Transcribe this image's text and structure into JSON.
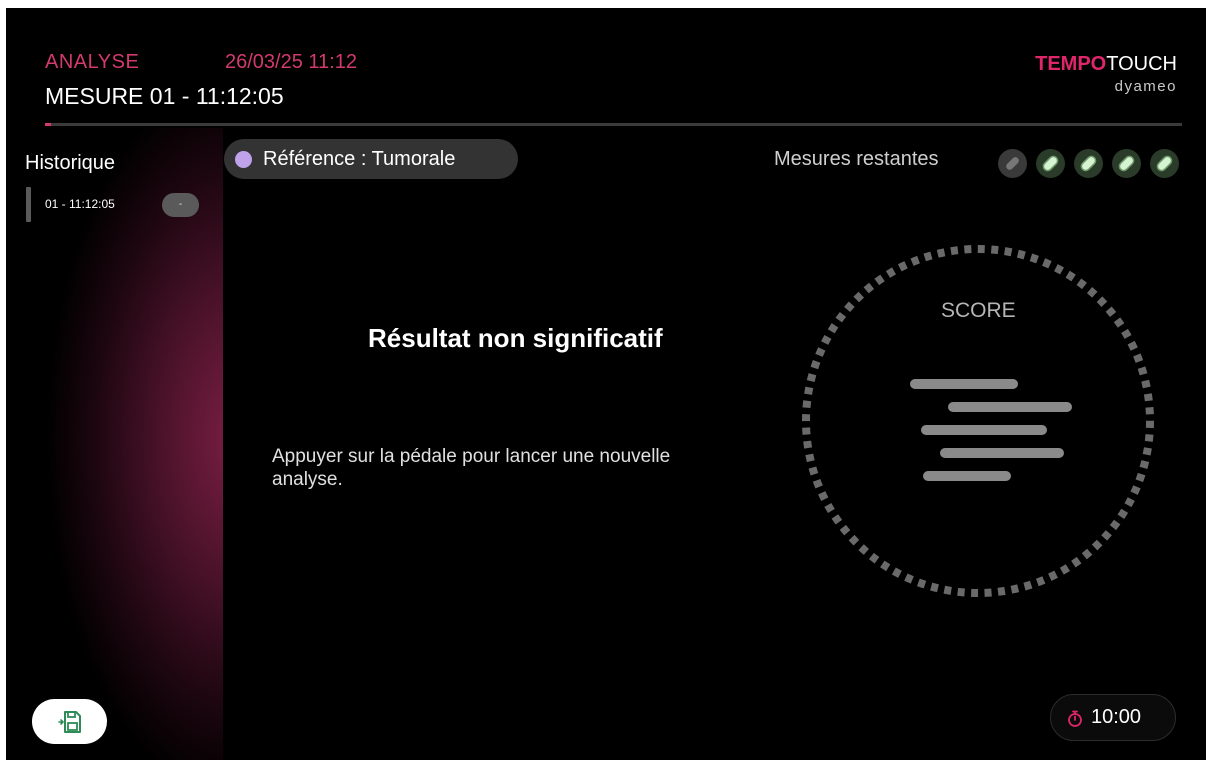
{
  "header": {
    "mode_label": "ANALYSE",
    "datetime": "26/03/25 11:12",
    "measure_title": "MESURE 01 - 11:12:05",
    "progress_fraction": 0.005
  },
  "brand": {
    "tempo": "TEMPO",
    "touch": "TOUCH",
    "sub": "dyameo"
  },
  "sidebar": {
    "title": "Historique",
    "items": [
      {
        "label": "01 - 11:12:05",
        "badge": "-"
      }
    ]
  },
  "reference": {
    "label": "Référence : Tumorale",
    "dot_color": "#bfa2ea"
  },
  "mesures": {
    "label": "Mesures restantes",
    "total": 5,
    "used": 1
  },
  "result": {
    "title": "Résultat non significatif",
    "instruction": "Appuyer sur la pédale pour lancer une nouvelle analyse."
  },
  "score": {
    "label": "SCORE"
  },
  "timer": {
    "value": "10:00"
  },
  "icons": {
    "save": "save-icon",
    "timer": "stopwatch-icon"
  },
  "colors": {
    "accent": "#d23a6e",
    "brand": "#e0266a",
    "available": "#d6f3d2"
  }
}
